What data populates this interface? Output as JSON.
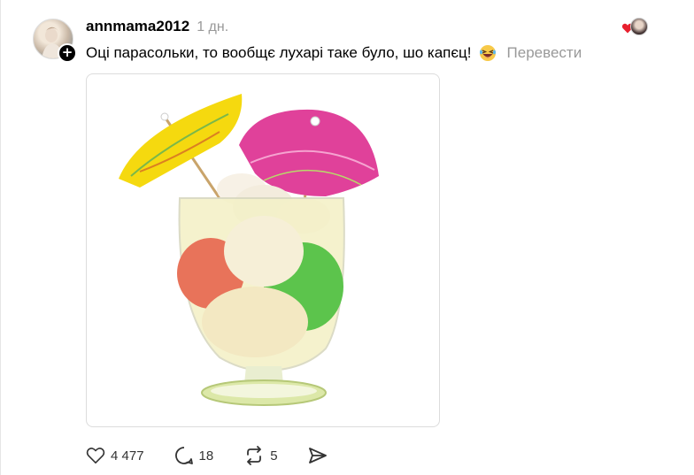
{
  "post": {
    "username": "annmama2012",
    "time": "1 дн.",
    "text": "Оці парасольки, то вообщє лухарі таке було, шо капєц!",
    "translate_label": "Перевести",
    "follow_symbol": "+"
  },
  "actions": {
    "likes": "4 477",
    "comments": "18",
    "reposts": "5"
  },
  "colors": {
    "heart_red": "#e8202e",
    "muted_text": "#999999",
    "border": "#dcdcdc"
  },
  "icons": [
    "heart-icon",
    "comment-icon",
    "repost-icon",
    "share-icon",
    "laughing-emoji-icon"
  ]
}
